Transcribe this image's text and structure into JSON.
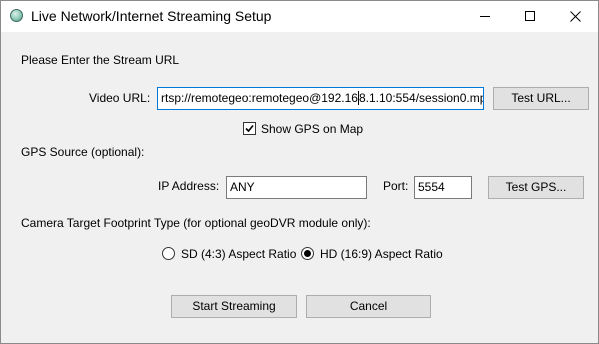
{
  "window": {
    "title": "Live Network/Internet Streaming Setup"
  },
  "stream": {
    "heading": "Please Enter the Stream URL",
    "video_url_label": "Video URL:",
    "video_url_value_a": "rtsp://remotegeo:remotegeo@192.16",
    "video_url_value_b": "8.1.10:554/session0.mp",
    "test_url_label": "Test URL...",
    "show_gps_label": "Show GPS on Map",
    "show_gps_checked": true
  },
  "gps": {
    "heading": "GPS Source (optional):",
    "ip_label": "IP Address:",
    "ip_value": "ANY",
    "port_label": "Port:",
    "port_value": "5554",
    "test_gps_label": "Test GPS..."
  },
  "footprint": {
    "heading": "Camera Target Footprint Type (for optional geoDVR module only):",
    "options": [
      {
        "label": "SD (4:3) Aspect Ratio",
        "selected": false
      },
      {
        "label": "HD (16:9) Aspect Ratio",
        "selected": true
      }
    ]
  },
  "actions": {
    "start_label": "Start Streaming",
    "cancel_label": "Cancel"
  },
  "colors": {
    "focus_border": "#0078d7",
    "button_face": "#e1e1e1",
    "dialog_background": "#f0f0f0"
  },
  "icons": {
    "app": "globe-icon",
    "minimize": "minimize-icon",
    "maximize": "maximize-icon",
    "close": "close-icon",
    "check": "checkmark-icon"
  }
}
